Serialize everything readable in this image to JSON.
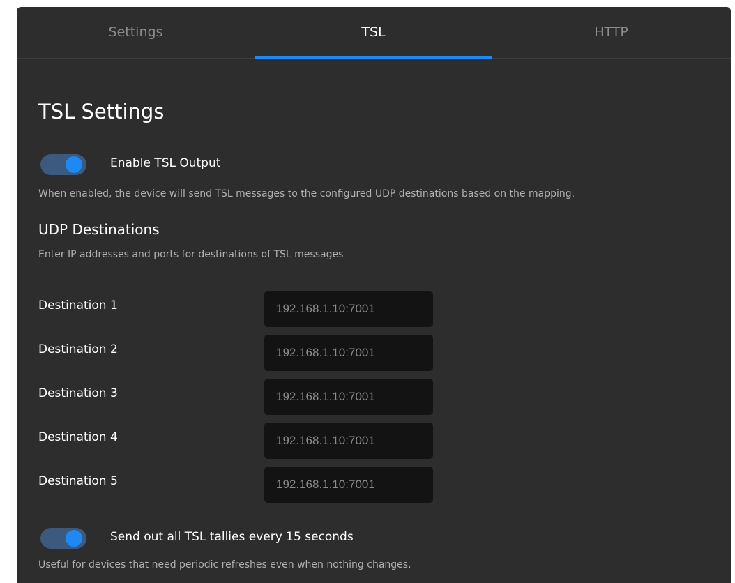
{
  "tabs": [
    {
      "label": "Settings",
      "active": false
    },
    {
      "label": "TSL",
      "active": true
    },
    {
      "label": "HTTP",
      "active": false
    }
  ],
  "page_title": "TSL Settings",
  "enable_output": {
    "label": "Enable TSL Output",
    "enabled": true,
    "description": "When enabled, the device will send TSL messages to the configured UDP destinations based on the mapping."
  },
  "udp": {
    "title": "UDP Destinations",
    "description": "Enter IP addresses and ports for destinations of TSL messages",
    "destinations": [
      {
        "label": "Destination 1",
        "placeholder": "192.168.1.10:7001"
      },
      {
        "label": "Destination 2",
        "placeholder": "192.168.1.10:7001"
      },
      {
        "label": "Destination 3",
        "placeholder": "192.168.1.10:7001"
      },
      {
        "label": "Destination 4",
        "placeholder": "192.168.1.10:7001"
      },
      {
        "label": "Destination 5",
        "placeholder": "192.168.1.10:7001"
      }
    ]
  },
  "periodic": {
    "label": "Send out all TSL tallies every 15 seconds",
    "enabled": true,
    "description": "Useful for devices that need periodic refreshes even when nothing changes."
  },
  "colors": {
    "accent": "#1e88f5",
    "panel_bg": "#2d2d2d",
    "input_bg": "#131313"
  }
}
